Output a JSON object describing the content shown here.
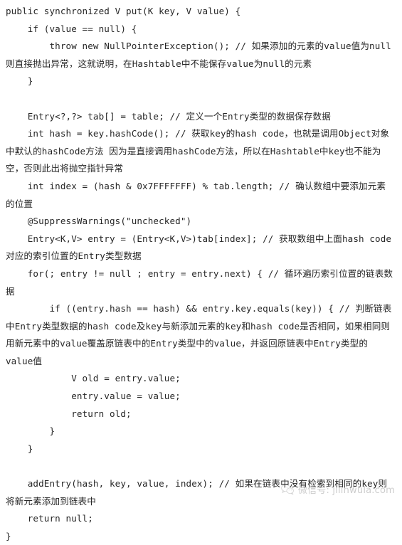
{
  "document": {
    "type": "java-code-listing",
    "language": "Java",
    "background_color": "#ffffff",
    "text_color": "#262626",
    "lines": [
      "public synchronized V put(K key, V value) {",
      "    if (value == null) {",
      "        throw new NullPointerException(); // 如果添加的元素的value值为null则直接抛出异常，这就说明，在Hashtable中不能保存value为null的元素",
      "    }",
      "",
      "    Entry<?,?> tab[] = table; // 定义一个Entry类型的数据保存数据",
      "    int hash = key.hashCode(); // 获取key的hash code，也就是调用Object对象中默认的hashCode方法 因为是直接调用hashCode方法，所以在Hashtable中key也不能为空，否则此出将抛空指针异常",
      "    int index = (hash & 0x7FFFFFFF) % tab.length; // 确认数组中要添加元素的位置",
      "    @SuppressWarnings(\"unchecked\")",
      "    Entry<K,V> entry = (Entry<K,V>)tab[index]; // 获取数组中上面hash code对应的索引位置的Entry类型数据",
      "    for(; entry != null ; entry = entry.next) { // 循环遍历索引位置的链表数据",
      "        if ((entry.hash == hash) && entry.key.equals(key)) { // 判断链表中Entry类型数据的hash code及key与新添加元素的key和hash code是否相同，如果相同则用新元素中的value覆盖原链表中的Entry类型中的value，并返回原链表中Entry类型的value值",
      "            V old = entry.value;",
      "            entry.value = value;",
      "            return old;",
      "        }",
      "    }",
      "",
      "    addEntry(hash, key, value, index); // 如果在链表中没有检索到相同的key则将新元素添加到链表中",
      "    return null;",
      "}"
    ]
  },
  "watermark": {
    "icon": "wechat-icon",
    "text": "微信号: jilinwula.com",
    "color": "#5a5a5a"
  }
}
